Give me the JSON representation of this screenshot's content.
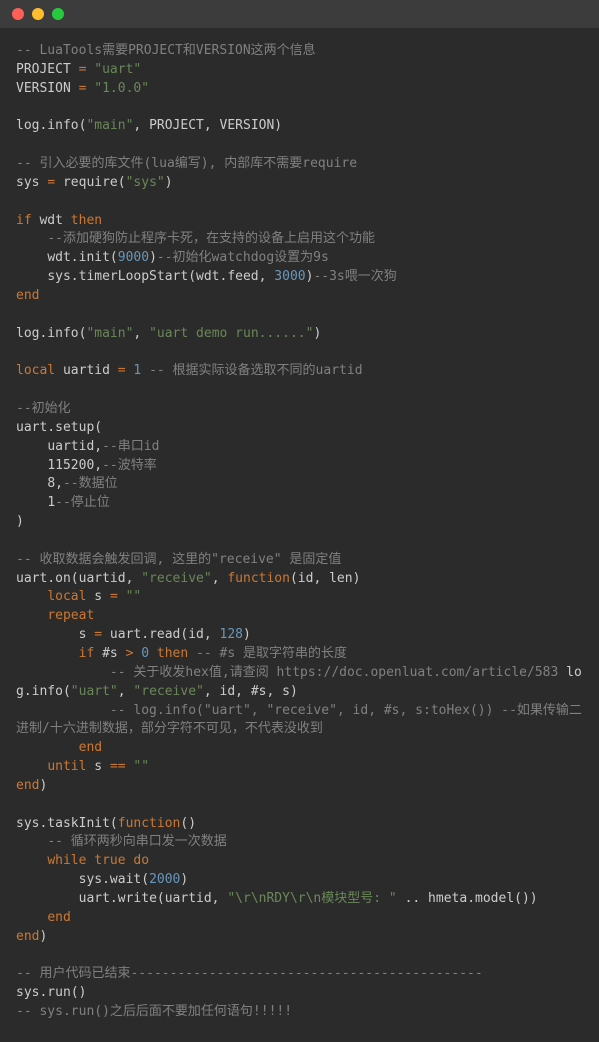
{
  "code": {
    "l1": "-- LuaTools需要PROJECT和VERSION这两个信息",
    "l2a": "PROJECT ",
    "l2b": "=",
    "l2c": " \"uart\"",
    "l3a": "VERSION ",
    "l3b": "=",
    "l3c": " \"1.0.0\"",
    "l4a": "log.info(",
    "l4b": "\"main\"",
    "l4c": ", PROJECT, VERSION)",
    "l5": "-- 引入必要的库文件(lua编写), 内部库不需要require",
    "l6a": "sys ",
    "l6b": "=",
    "l6c": " require(",
    "l6d": "\"sys\"",
    "l6e": ")",
    "l7a": "if",
    "l7b": " wdt ",
    "l7c": "then",
    "l8": "    --添加硬狗防止程序卡死，在支持的设备上启用这个功能",
    "l9a": "    wdt.init(",
    "l9b": "9000",
    "l9c": ")",
    "l9d": "--初始化watchdog设置为9s",
    "l10a": "    sys.timerLoopStart(wdt.feed, ",
    "l10b": "3000",
    "l10c": ")",
    "l10d": "--3s喂一次狗",
    "l11": "end",
    "l12a": "log.info(",
    "l12b": "\"main\"",
    "l12c": ", ",
    "l12d": "\"uart demo run......\"",
    "l12e": ")",
    "l13a": "local",
    "l13b": " uartid ",
    "l13c": "=",
    "l13d": " 1",
    "l13e": " -- 根据实际设备选取不同的uartid",
    "l14": "--初始化",
    "l15": "uart.setup(",
    "l16a": "    uartid,",
    "l16b": "--串口id",
    "l17a": "    115200,",
    "l17b": "--波特率",
    "l18a": "    8,",
    "l18b": "--数据位",
    "l19a": "    1",
    "l19b": "--停止位",
    "l20": ")",
    "l21": "-- 收取数据会触发回调, 这里的\"receive\" 是固定值",
    "l22a": "uart.on(uartid, ",
    "l22b": "\"receive\"",
    "l22c": ", ",
    "l22d": "function",
    "l22e": "(id, len)",
    "l23a": "    local",
    "l23b": " s ",
    "l23c": "=",
    "l23d": " \"\"",
    "l24": "    repeat",
    "l25a": "        s ",
    "l25b": "=",
    "l25c": " uart.read(id, ",
    "l25d": "128",
    "l25e": ")",
    "l26a": "        if",
    "l26b": " #s ",
    "l26c": ">",
    "l26d": " 0",
    "l26e": " then",
    "l26f": " -- #s 是取字符串的长度",
    "l27": "            -- 关于收发hex值,请查阅 https://doc.openluat.com/article/583 ",
    "l27b": "log.info(",
    "l27c": "\"uart\"",
    "l27d": ", ",
    "l27e": "\"receive\"",
    "l27f": ", id, #s, s)",
    "l28": "            -- log.info(\"uart\", \"receive\", id, #s, s:toHex()) --如果传输二进制/十六进制数据，部分字符不可见，不代表没收到",
    "l29": "        end",
    "l30a": "    until",
    "l30b": " s ",
    "l30c": "==",
    "l30d": " \"\"",
    "l31a": "end",
    "l31b": ")",
    "l32a": "sys.taskInit(",
    "l32b": "function",
    "l32c": "()",
    "l33": "    -- 循环两秒向串口发一次数据",
    "l34a": "    while",
    "l34b": " true",
    "l34c": " do",
    "l35a": "        sys.wait(",
    "l35b": "2000",
    "l35c": ")",
    "l36a": "        uart.write(uartid, ",
    "l36b": "\"\\r\\nRDY\\r\\n模块型号: \"",
    "l36c": " .. hmeta.model())",
    "l37": "    end",
    "l38a": "end",
    "l38b": ")",
    "l39": "-- 用户代码已结束---------------------------------------------",
    "l40": "sys.run()",
    "l41": "-- sys.run()之后后面不要加任何语句!!!!!"
  }
}
